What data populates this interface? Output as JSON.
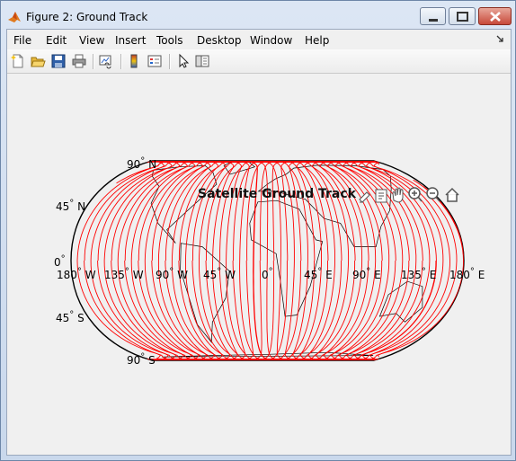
{
  "window": {
    "title": "Figure 2: Ground Track"
  },
  "menu": {
    "items": [
      "File",
      "Edit",
      "View",
      "Insert",
      "Tools",
      "Desktop",
      "Window",
      "Help"
    ]
  },
  "toolbar": {
    "tools": [
      "new-figure-icon",
      "open-file-icon",
      "save-icon",
      "print-icon",
      "link-plot-icon",
      "colorbar-icon",
      "legend-icon",
      "edit-plot-icon",
      "property-inspector-icon"
    ]
  },
  "plot": {
    "title": "Satellite Ground Track",
    "lat_labels": [
      "90",
      "N",
      "45",
      "N",
      "0",
      "45",
      "S",
      "90",
      "S"
    ],
    "lon_labels": [
      "180",
      "W",
      "135",
      "W",
      "90",
      "W",
      "45",
      "W",
      "0",
      "45",
      "E",
      "90",
      "E",
      "135",
      "E",
      "180",
      "E"
    ],
    "degree_symbol": "°",
    "track_color": "#ff0000",
    "coast_color": "#000000",
    "axes_tools": [
      "brush-icon",
      "datatip-icon",
      "pan-icon",
      "zoom-in-icon",
      "zoom-out-icon",
      "home-icon"
    ]
  }
}
